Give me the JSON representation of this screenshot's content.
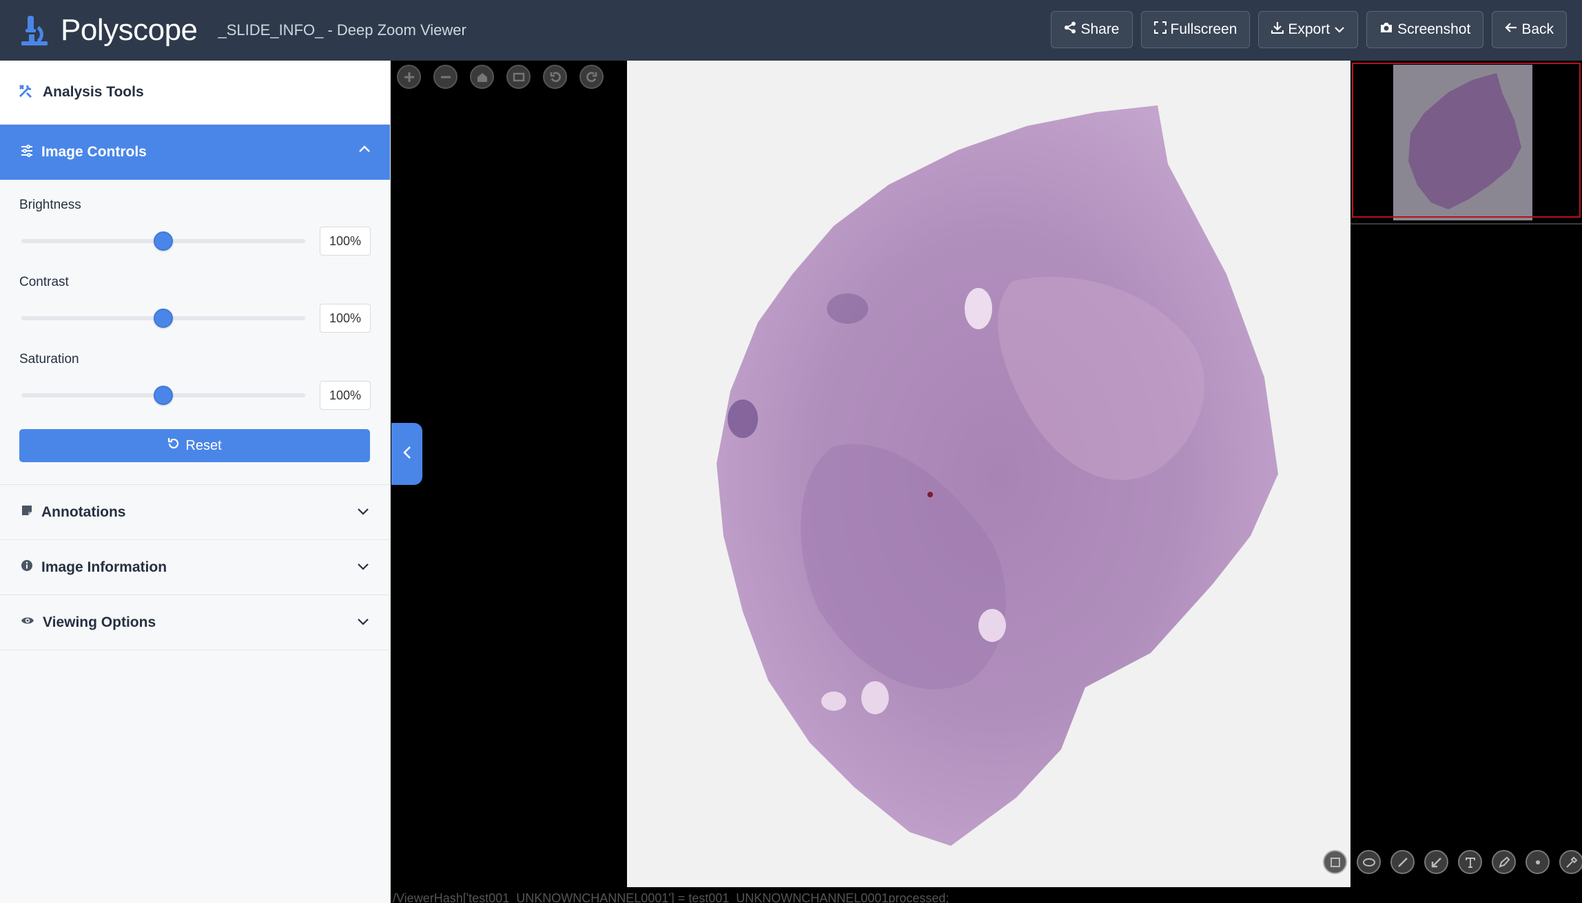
{
  "app": {
    "brand": "Polyscope",
    "page_title": "_SLIDE_INFO_ - Deep Zoom Viewer",
    "accent_color": "#4a86e8",
    "header_color": "#2e3a4b"
  },
  "header_actions": [
    {
      "label": "Share",
      "icon": "share-icon"
    },
    {
      "label": "Fullscreen",
      "icon": "expand-icon"
    },
    {
      "label": "Export",
      "icon": "download-icon"
    },
    {
      "label": "Screenshot",
      "icon": "camera-icon"
    },
    {
      "label": "Back",
      "icon": "arrow-left-icon"
    }
  ],
  "sidebar": {
    "analysis_tools": {
      "label": "Analysis Tools",
      "icon": "tools-icon"
    },
    "image_controls": {
      "label": "Image Controls",
      "icon": "sliders-icon",
      "expanded": true,
      "brightness": {
        "label": "Brightness",
        "value": "100%",
        "level": 0.5
      },
      "contrast": {
        "label": "Contrast",
        "value": "100%",
        "level": 0.5
      },
      "saturation": {
        "label": "Saturation",
        "value": "100%",
        "level": 0.5
      },
      "reset_label": "Reset"
    },
    "annotations": {
      "label": "Annotations",
      "icon": "sticky-note-icon"
    },
    "image_information": {
      "label": "Image Information",
      "icon": "info-circle-icon"
    },
    "viewing_options": {
      "label": "Viewing Options",
      "icon": "eye-icon"
    }
  },
  "viewer": {
    "nav_buttons": [
      "zoom-in-icon",
      "zoom-out-icon",
      "home-icon",
      "fullpage-icon",
      "rotate-left-icon",
      "rotate-right-icon"
    ],
    "draw_tools": [
      "rectangle-icon",
      "ellipse-icon",
      "line-icon",
      "arrow-icon",
      "text-icon",
      "pencil-icon",
      "point-icon",
      "eyedropper-icon"
    ],
    "debug_text": "/ViewerHash['test001_UNKNOWNCHANNEL0001'] = test001_UNKNOWNCHANNEL0001processed;"
  }
}
